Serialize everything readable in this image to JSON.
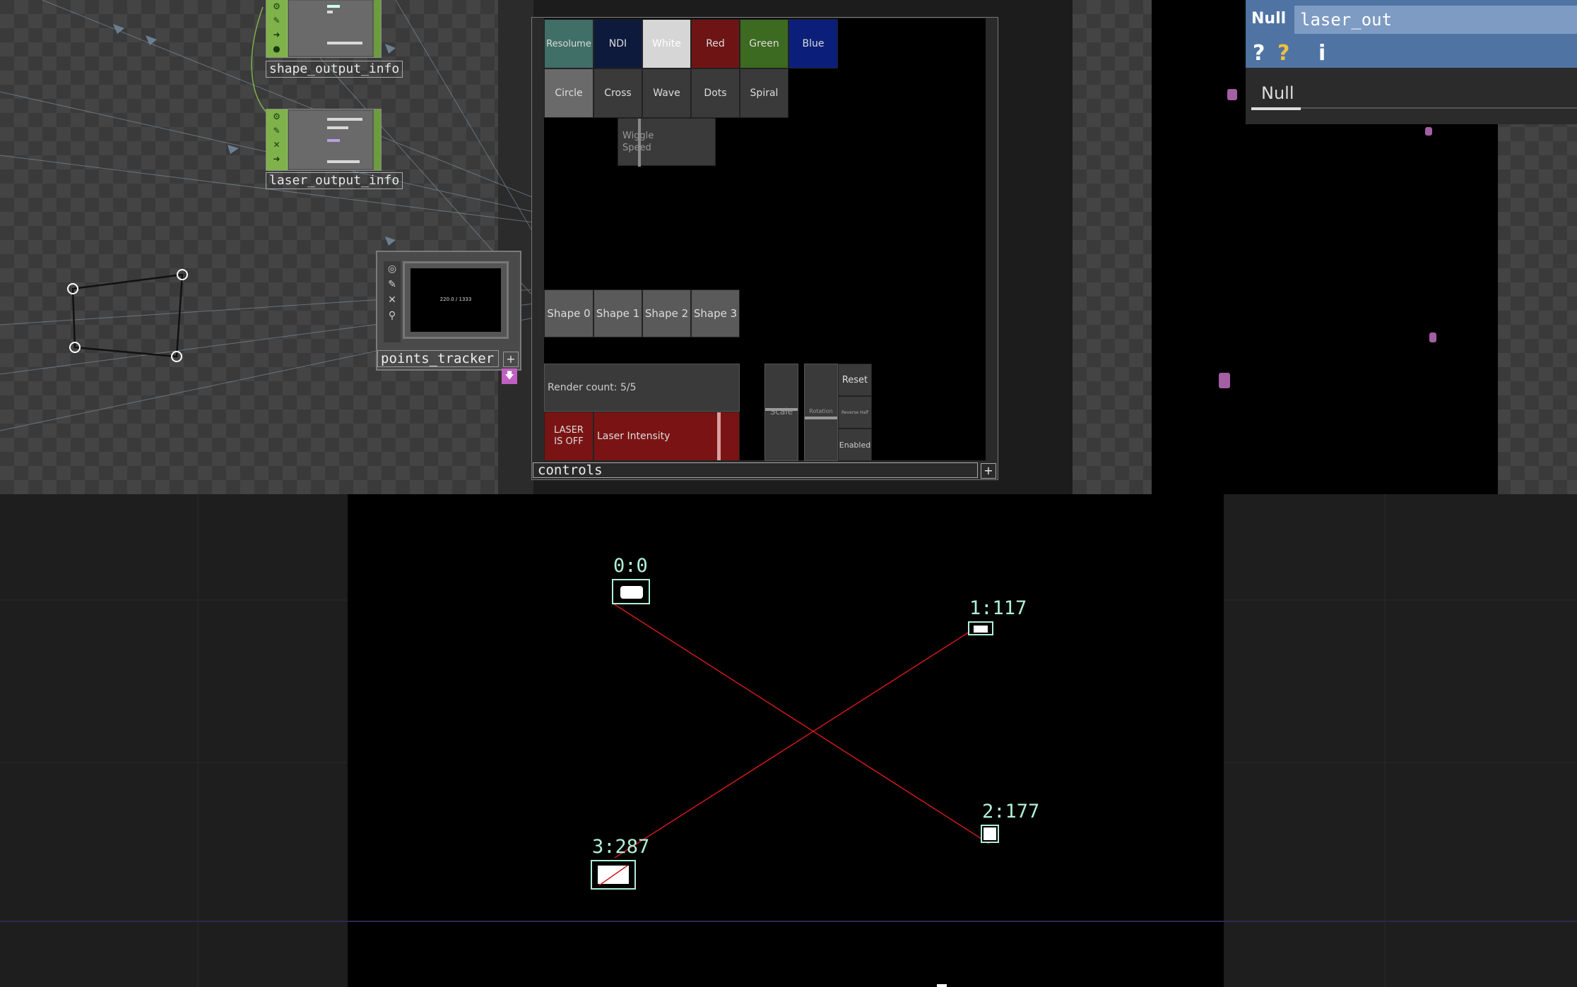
{
  "network": {
    "nodes": [
      {
        "label": "shape_output_info"
      },
      {
        "label": "laser_output_info"
      }
    ],
    "node_strip_icons": [
      "⚙",
      "✎",
      "✕",
      "➜",
      "●"
    ],
    "points_tracker": {
      "label": "points_tracker",
      "readout": "220.0 / 1333",
      "plus": "+",
      "down": "🡇",
      "icons": [
        "◎",
        "✎",
        "✕",
        "⚲"
      ]
    }
  },
  "controls": {
    "label": "controls",
    "plus": "+",
    "output_buttons": [
      {
        "label": "Resolume",
        "color": "#3f6f66"
      },
      {
        "label": "NDI",
        "color": "#0d1a3c"
      },
      {
        "label": "White",
        "color": "#d6d6d6"
      },
      {
        "label": "Red",
        "color": "#6e1414"
      },
      {
        "label": "Green",
        "color": "#3c6a20"
      },
      {
        "label": "Blue",
        "color": "#0b1f7a"
      }
    ],
    "pattern_buttons": [
      {
        "label": "Circle",
        "color": "#6a6a6a"
      },
      {
        "label": "Cross",
        "color": "#3a3a3a"
      },
      {
        "label": "Wave",
        "color": "#3a3a3a"
      },
      {
        "label": "Dots",
        "color": "#3a3a3a"
      },
      {
        "label": "Spiral",
        "color": "#3a3a3a"
      }
    ],
    "wiggle_speed": "Wiggle Speed",
    "shape_buttons": [
      "Shape 0",
      "Shape 1",
      "Shape 2",
      "Shape 3"
    ],
    "render_count": "Render count: 5/5",
    "laser_status": "LASER IS OFF",
    "laser_intensity": "Laser Intensity",
    "scale": "Scale",
    "rotation": "Rotation",
    "reset": "Reset",
    "reverse": "Reverse Half",
    "enabled": "Enabled"
  },
  "null_panel": {
    "type": "Null",
    "name": "laser_out",
    "tab": "Null",
    "icons": [
      "?",
      "?",
      "i"
    ]
  },
  "projection": {
    "points": [
      {
        "label": "0:0"
      },
      {
        "label": "1:117"
      },
      {
        "label": "2:177"
      },
      {
        "label": "3:287"
      }
    ]
  },
  "colors": {
    "accent_green": "#7fb24a",
    "laser_line": "#d01818",
    "point_label": "#b0f0d8",
    "null_header": "#4f74a3"
  }
}
